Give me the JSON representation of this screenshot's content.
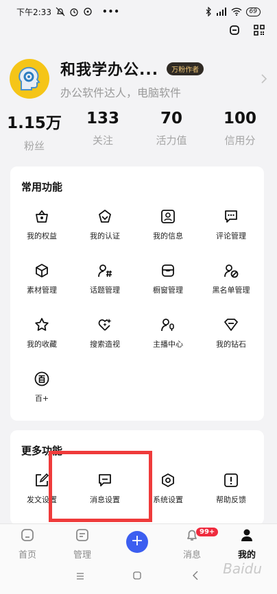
{
  "status_bar": {
    "time": "下午2:33",
    "battery": "69"
  },
  "profile": {
    "username": "和我学办公...",
    "badge": "万粉作者",
    "bio": "办公软件达人，电脑软件"
  },
  "stats": [
    {
      "value": "1.15万",
      "label": "粉丝"
    },
    {
      "value": "133",
      "label": "关注"
    },
    {
      "value": "70",
      "label": "活力值"
    },
    {
      "value": "100",
      "label": "信用分"
    }
  ],
  "common_functions": {
    "title": "常用功能",
    "items": [
      {
        "label": "我的权益",
        "icon": "gift-icon"
      },
      {
        "label": "我的认证",
        "icon": "verified-badge-icon"
      },
      {
        "label": "我的信息",
        "icon": "id-card-icon"
      },
      {
        "label": "评论管理",
        "icon": "comment-icon"
      },
      {
        "label": "素材管理",
        "icon": "cube-icon"
      },
      {
        "label": "话题管理",
        "icon": "topic-hashtag-icon"
      },
      {
        "label": "橱窗管理",
        "icon": "shop-window-icon"
      },
      {
        "label": "黑名单管理",
        "icon": "blocked-user-icon"
      },
      {
        "label": "我的收藏",
        "icon": "star-icon"
      },
      {
        "label": "搜索造视",
        "icon": "sparkle-heart-icon"
      },
      {
        "label": "主播中心",
        "icon": "anchor-mic-icon"
      },
      {
        "label": "我的钻石",
        "icon": "diamond-icon"
      },
      {
        "label": "百+",
        "icon": "bai-plus-icon"
      }
    ]
  },
  "more_functions": {
    "title": "更多功能",
    "items": [
      {
        "label": "发文设置",
        "icon": "edit-icon"
      },
      {
        "label": "消息设置",
        "icon": "message-icon"
      },
      {
        "label": "系统设置",
        "icon": "settings-hex-icon"
      },
      {
        "label": "帮助反馈",
        "icon": "feedback-icon"
      }
    ]
  },
  "tabbar": {
    "items": [
      {
        "label": "首页",
        "icon": "home-icon"
      },
      {
        "label": "管理",
        "icon": "manage-icon"
      },
      {
        "label": "",
        "icon": "plus-icon"
      },
      {
        "label": "消息",
        "icon": "bell-icon",
        "badge": "99+"
      },
      {
        "label": "我的",
        "icon": "person-icon",
        "active": true
      }
    ]
  },
  "watermark": "Baidu"
}
